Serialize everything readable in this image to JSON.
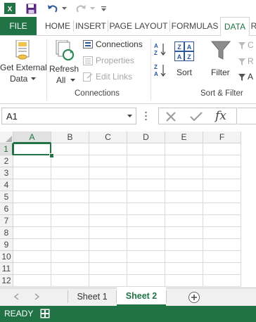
{
  "qat": {
    "save_icon": "save-icon",
    "undo_icon": "undo-icon",
    "redo_icon": "redo-icon",
    "customize_icon": "customize-icon"
  },
  "tabs": [
    {
      "label": "FILE"
    },
    {
      "label": "HOME"
    },
    {
      "label": "INSERT"
    },
    {
      "label": "PAGE LAYOUT"
    },
    {
      "label": "FORMULAS"
    },
    {
      "label": "DATA"
    },
    {
      "label": "R"
    }
  ],
  "ribbon": {
    "get_external_data": {
      "line1": "Get External",
      "line2": "Data"
    },
    "refresh_all": {
      "line1": "Refresh",
      "line2": "All"
    },
    "connections": "Connections",
    "properties": "Properties",
    "edit_links": "Edit Links",
    "connections_group": "Connections",
    "sort": "Sort",
    "filter": "Filter",
    "sort_filter_group": "Sort & Filter",
    "partial_right": [
      "C",
      "R",
      "A"
    ]
  },
  "formula_bar": {
    "name_box": "A1",
    "fx": "fx"
  },
  "grid": {
    "columns": [
      "A",
      "B",
      "C",
      "D",
      "E",
      "F"
    ],
    "rows": [
      "1",
      "2",
      "3",
      "4",
      "5",
      "6",
      "7",
      "8",
      "9",
      "10",
      "11",
      "12"
    ],
    "selected_cell": "A1"
  },
  "sheets": {
    "tab1": "Sheet 1",
    "tab2": "Sheet 2"
  },
  "status": {
    "text": "READY"
  }
}
